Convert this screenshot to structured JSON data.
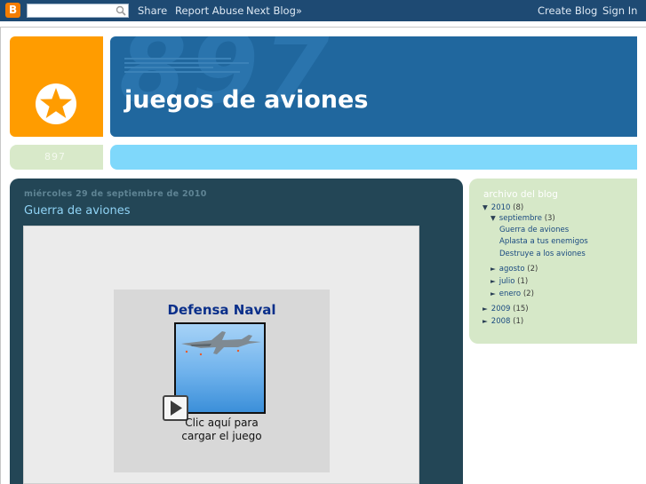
{
  "navbar": {
    "logo_letter": "B",
    "search_placeholder": "",
    "share": "Share",
    "report_abuse": "Report Abuse",
    "next_blog": "Next Blog»",
    "create_blog": "Create Blog",
    "sign_in": "Sign In"
  },
  "header": {
    "title": "juegos de aviones",
    "bg_number": "897",
    "description_number": "897"
  },
  "post": {
    "date": "miércoles 29 de septiembre de 2010",
    "title": "Guerra de aviones",
    "game_title": "Defensa Naval",
    "caption_line1": "Clic aquí para",
    "caption_line2": "cargar el juego"
  },
  "sidebar": {
    "title": "archivo del blog",
    "items": [
      {
        "arrow": "▼",
        "label": "2010",
        "count": "(8)"
      },
      {
        "arrow": "▼",
        "label": "septiembre",
        "count": "(3)"
      },
      {
        "label": "Guerra de aviones"
      },
      {
        "label": "Aplasta a tus enemigos"
      },
      {
        "label": "Destruye a los aviones"
      },
      {
        "arrow": "►",
        "label": "agosto",
        "count": "(2)"
      },
      {
        "arrow": "►",
        "label": "julio",
        "count": "(1)"
      },
      {
        "arrow": "►",
        "label": "enero",
        "count": "(2)"
      },
      {
        "arrow": "►",
        "label": "2009",
        "count": "(15)"
      },
      {
        "arrow": "►",
        "label": "2008",
        "count": "(1)"
      }
    ]
  },
  "colors": {
    "navbar": "#1e4a73",
    "logo_orange": "#ff9c00",
    "header_blue": "#20679e",
    "main_dark": "#234656",
    "sidebar_green": "#d6e8c8",
    "title_link": "#8fd3f5"
  }
}
